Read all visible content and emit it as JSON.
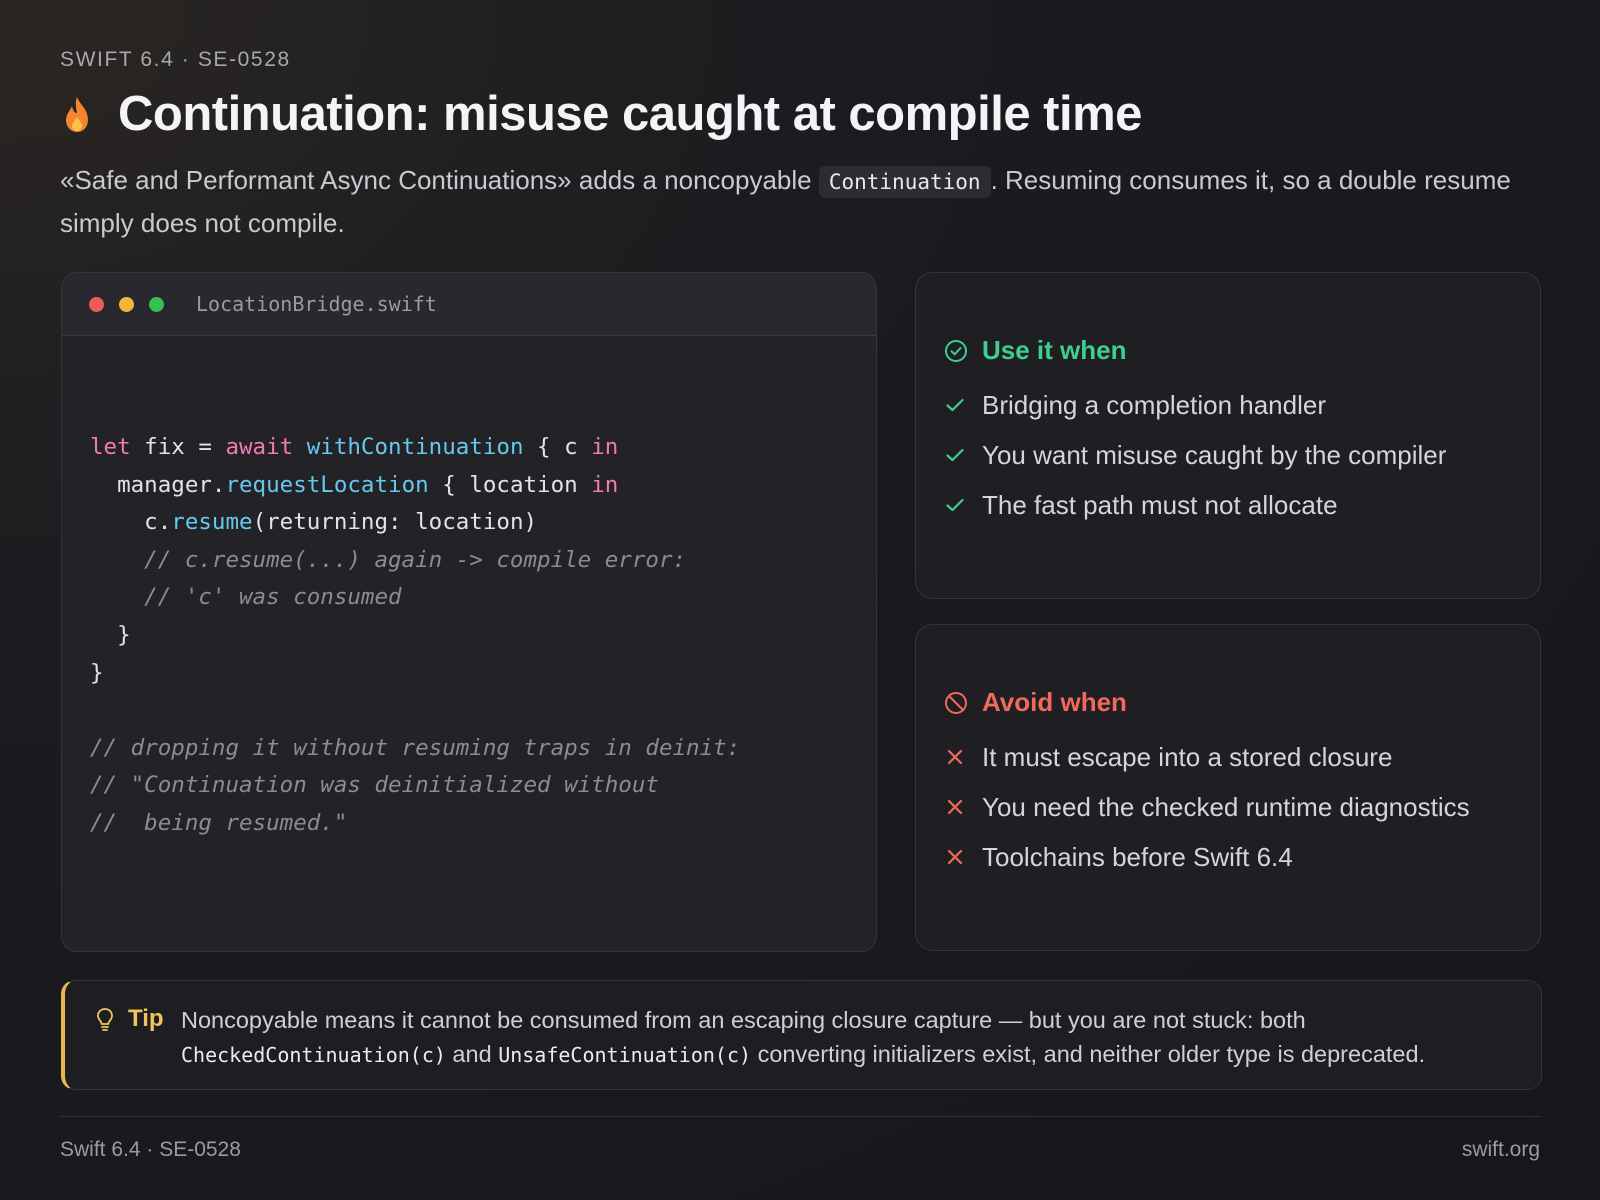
{
  "header": {
    "eyebrow": "SWIFT 6.4 · SE-0528",
    "icon": "flame-icon",
    "title": "Continuation: misuse caught at compile time",
    "lede_part1": "«Safe and Performant Async Continuations» adds a noncopyable ",
    "lede_code": "Continuation",
    "lede_part2": ". Resuming consumes it, so a double resume simply does not compile."
  },
  "code_card": {
    "filename": "LocationBridge.swift",
    "window_dots": [
      "#ef5b5b",
      "#f2b63c",
      "#33c150"
    ],
    "tokens": {
      "t1": "let",
      "t2": " fix = ",
      "t3": "await",
      "t4": " ",
      "t5": "withContinuation",
      "t6": " { c ",
      "t7": "in",
      "t8": "\n  manager.",
      "t9": "requestLocation",
      "t10": " { location ",
      "t11": "in",
      "t12": "\n    c.",
      "t13": "resume",
      "t14": "(returning: location)\n",
      "t15": "    // c.resume(...) again -> compile error:\n    // 'c' was consumed",
      "t16": "\n  }\n}\n\n",
      "t17": "// dropping it without resuming traps in deinit:\n// \"Continuation was deinitialized without\n//  being resumed.\""
    }
  },
  "use_panel": {
    "heading": "Use it when",
    "color": "#3ecf8e",
    "items": [
      "Bridging a completion handler",
      "You want misuse caught by the compiler",
      "The fast path must not allocate"
    ]
  },
  "avoid_panel": {
    "heading": "Avoid when",
    "color": "#f06a5a",
    "items": [
      "It must escape into a stored closure",
      "You need the checked runtime diagnostics",
      "Toolchains before Swift 6.4"
    ]
  },
  "tip": {
    "label": "Tip",
    "part1": "Noncopyable means it cannot be consumed from an escaping closure capture — but you are not stuck: both ",
    "code1": "CheckedContinuation(c)",
    "part2": " and ",
    "code2": "UnsafeContinuation(c)",
    "part3": " converting initializers exist, and neither older type is deprecated."
  },
  "footer": {
    "left": "Swift 6.4 · SE-0528",
    "right": "swift.org"
  }
}
